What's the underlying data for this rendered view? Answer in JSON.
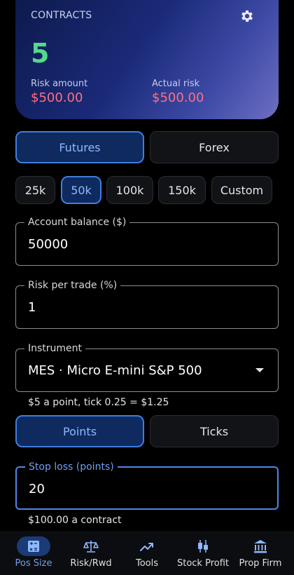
{
  "summary": {
    "label": "CONTRACTS",
    "count": "5",
    "risk_amount_label": "Risk amount",
    "risk_amount_value": "$500.00",
    "actual_risk_label": "Actual risk",
    "actual_risk_value": "$500.00"
  },
  "market_toggle": {
    "futures": "Futures",
    "forex": "Forex",
    "selected": "Futures"
  },
  "presets": {
    "items": [
      "25k",
      "50k",
      "100k",
      "150k",
      "Custom"
    ],
    "selected": "50k"
  },
  "account_balance": {
    "label": "Account balance ($)",
    "value": "50000"
  },
  "risk_per_trade": {
    "label": "Risk per trade (%)",
    "value": "1"
  },
  "instrument": {
    "label": "Instrument",
    "value": "MES · Micro E-mini S&P 500",
    "hint": "$5 a point, tick 0.25 = $1.25"
  },
  "unit_toggle": {
    "points": "Points",
    "ticks": "Ticks",
    "selected": "Points"
  },
  "stop_loss": {
    "label": "Stop loss (points)",
    "value": "20",
    "hint": "$100.00 a contract"
  },
  "colors": {
    "accent": "#3f7fe0",
    "count_green": "#55d98a",
    "risk_red": "#ff6f82"
  },
  "nav": {
    "items": [
      {
        "label": "Pos Size",
        "icon": "calculator-icon"
      },
      {
        "label": "Risk/Rwd",
        "icon": "scale-icon"
      },
      {
        "label": "Tools",
        "icon": "trend-icon"
      },
      {
        "label": "Stock Profit",
        "icon": "candlestick-icon"
      },
      {
        "label": "Prop Firm",
        "icon": "bank-icon"
      }
    ],
    "active": "Pos Size"
  }
}
